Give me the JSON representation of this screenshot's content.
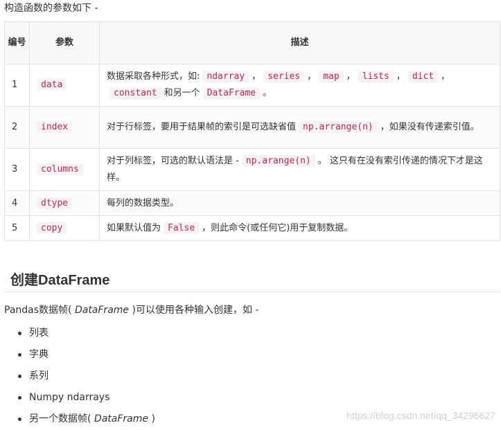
{
  "intro": "构造函数的参数如下 -",
  "table": {
    "headers": {
      "num": "编号",
      "param": "参数",
      "desc": "描述"
    },
    "rows": [
      {
        "num": "1",
        "param": "data"
      },
      {
        "num": "2",
        "param": "index"
      },
      {
        "num": "3",
        "param": "columns"
      },
      {
        "num": "4",
        "param": "dtype"
      },
      {
        "num": "5",
        "param": "copy"
      }
    ],
    "row1_desc": {
      "prefix": "数据采取各种形式，如:",
      "sep": "，",
      "types": [
        "ndarray",
        "series",
        "map",
        "lists",
        "dict",
        "constant"
      ],
      "and_another": "和另一个",
      "df": "DataFrame",
      "end": "。"
    },
    "row2_desc": {
      "pre": "对于行标签，要用于结果帧的索引是可选缺省值",
      "code": "np.arrange(n)",
      "post": "，如果没有传递索引值。"
    },
    "row3_desc": {
      "pre": "对于列标签，可选的默认语法是 -",
      "code": "np.arange(n)",
      "post": "。 这只有在没有索引传递的情况下才是这样。"
    },
    "row4_desc": "每列的数据类型。",
    "row5_desc": {
      "pre": "如果默认值为",
      "code": "False",
      "post": "，则此命令(或任何它)用于复制数据。"
    }
  },
  "heading": "创建DataFrame",
  "para": {
    "pre": "Pandas数据帧(",
    "em": "DataFrame",
    "post": ")可以使用各种输入创建，如 -"
  },
  "list_items": [
    "列表",
    "字典",
    "系列",
    "Numpy ndarrays"
  ],
  "last_item": {
    "pre": "另一个数据帧(",
    "em": "DataFrame",
    "post": ")"
  },
  "watermark": "https://blog.csdn.net/qq_34296627"
}
